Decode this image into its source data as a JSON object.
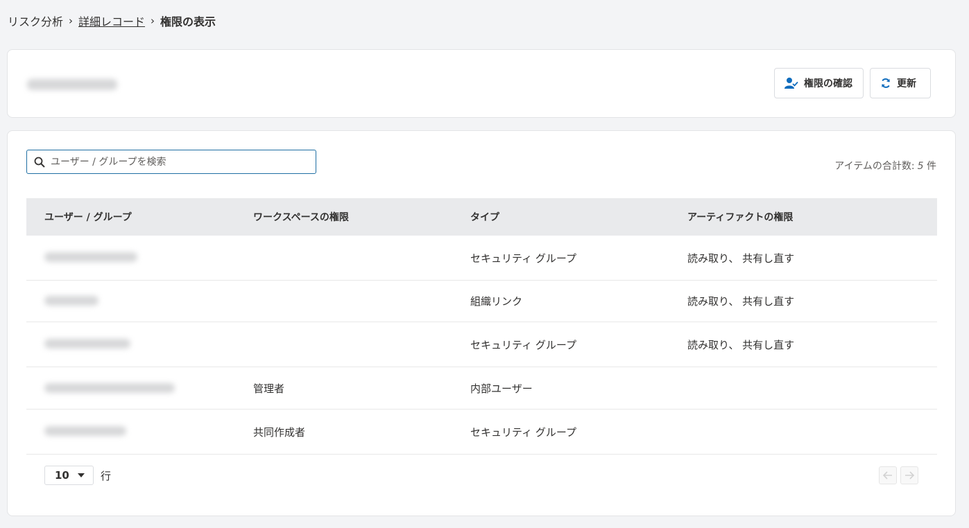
{
  "breadcrumb": {
    "root": "リスク分析",
    "middle": "詳細レコード",
    "current": "権限の表示"
  },
  "header": {
    "check_label": "権限の確認",
    "refresh_label": "更新"
  },
  "search": {
    "placeholder": "ユーザー / グループを検索"
  },
  "summary": {
    "total_label": "アイテムの合計数:",
    "total_count": "5",
    "unit": "件"
  },
  "table": {
    "headers": [
      "ユーザー / グループ",
      "ワークスペースの権限",
      "タイプ",
      "アーティファクトの権限"
    ],
    "rows": [
      {
        "workspace": "",
        "type": "セキュリティ グループ",
        "artifact": "読み取り、 共有し直す"
      },
      {
        "workspace": "",
        "type": "組織リンク",
        "artifact": "読み取り、 共有し直す"
      },
      {
        "workspace": "",
        "type": "セキュリティ グループ",
        "artifact": "読み取り、 共有し直す"
      },
      {
        "workspace": "管理者",
        "type": "内部ユーザー",
        "artifact": ""
      },
      {
        "workspace": "共同作成者",
        "type": "セキュリティ グループ",
        "artifact": ""
      }
    ]
  },
  "pagination": {
    "rows_per_page": "10",
    "rows_label": "行"
  },
  "colors": {
    "accent": "#1f6fa3",
    "icon_blue": "#0f6cbd"
  }
}
